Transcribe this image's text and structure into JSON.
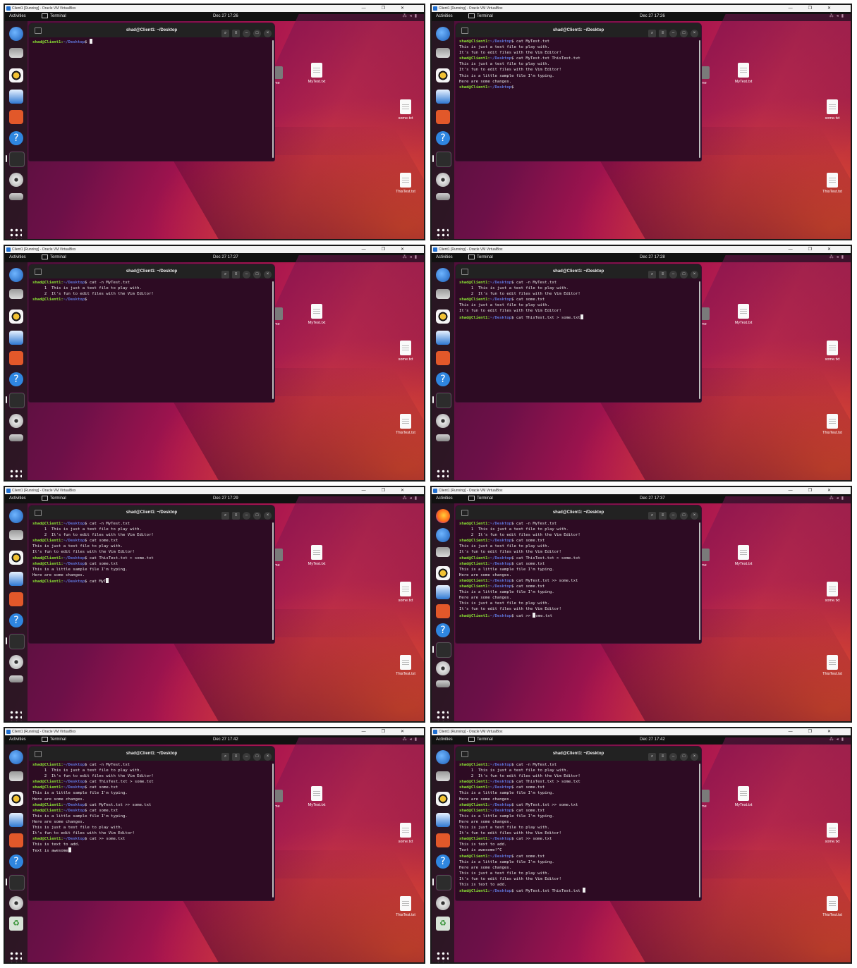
{
  "window_title": "Client1 [Running] - Oracle VM VirtualBox",
  "window_controls": [
    "—",
    "❐",
    "✕"
  ],
  "topbar": {
    "activities": "Activities",
    "app_name": "Terminal",
    "tray_icons": [
      "network-icon",
      "volume-icon",
      "battery-icon"
    ]
  },
  "terminal": {
    "title": "shad@Client1: ~/Desktop",
    "prompt_user": "shad@Client1:",
    "prompt_path": "~/Desktop",
    "prompt_sign": "$"
  },
  "desktop_files": [
    "MyTest.txt",
    "some.txt",
    "ThisTest.txt"
  ],
  "desktop_partial_label": "me",
  "dock_icons": [
    "thunderbird-icon",
    "files-icon",
    "rhythmbox-icon",
    "writer-icon",
    "app-center-icon",
    "help-icon",
    "terminal-icon",
    "disc-icon",
    "drive-icon",
    "show-apps-icon"
  ],
  "screens": [
    {
      "clock": "Dec 27  17:26",
      "lines": [
        {
          "p": true,
          "cmd": " ",
          "cursor": true
        }
      ],
      "term_height": 195
    },
    {
      "clock": "Dec 27  17:26",
      "lines": [
        {
          "p": true,
          "cmd": "cat MyTest.txt"
        },
        {
          "t": "This is just a test file to play with."
        },
        {
          "t": "It's fun to edit files with the Vim Editor!"
        },
        {
          "p": true,
          "cmd": "cat MyTest.txt ThisTest.txt"
        },
        {
          "t": "This is just a test file to play with."
        },
        {
          "t": "It's fun to edit files with the Vim Editor!"
        },
        {
          "t": "This is a little sample file I'm typing."
        },
        {
          "t": "Here are some changes."
        },
        {
          "p": true,
          "cmd": ""
        }
      ],
      "term_height": 195
    },
    {
      "clock": "Dec 27  17:27",
      "lines": [
        {
          "p": true,
          "cmd": "cat -n MyTest.txt"
        },
        {
          "t": "     1  This is just a test file to play with."
        },
        {
          "t": "     2  It's fun to edit files with the Vim Editor!"
        },
        {
          "p": true,
          "cmd": ""
        }
      ],
      "term_height": 195
    },
    {
      "clock": "Dec 27  17:28",
      "lines": [
        {
          "p": true,
          "cmd": "cat -n MyTest.txt"
        },
        {
          "t": "     1  This is just a test file to play with."
        },
        {
          "t": "     2  It's fun to edit files with the Vim Editor!"
        },
        {
          "p": true,
          "cmd": "cat some.txt"
        },
        {
          "t": "This is just a test file to play with."
        },
        {
          "t": "It's fun to edit files with the Vim Editor!"
        },
        {
          "p": true,
          "cmd": "cat ThisTest.txt > some.txt",
          "cursor": true
        }
      ],
      "term_height": 195
    },
    {
      "clock": "Dec 27  17:29",
      "lines": [
        {
          "p": true,
          "cmd": "cat -n MyTest.txt"
        },
        {
          "t": "     1  This is just a test file to play with."
        },
        {
          "t": "     2  It's fun to edit files with the Vim Editor!"
        },
        {
          "p": true,
          "cmd": "cat some.txt"
        },
        {
          "t": "This is just a test file to play with."
        },
        {
          "t": "It's fun to edit files with the Vim Editor!"
        },
        {
          "p": true,
          "cmd": "cat ThisTest.txt > some.txt"
        },
        {
          "p": true,
          "cmd": "cat some.txt"
        },
        {
          "t": "This is a little sample file I'm typing."
        },
        {
          "t": "Here are some changes."
        },
        {
          "p": true,
          "cmd": "cat MyT",
          "cursor": true
        }
      ],
      "term_height": 195
    },
    {
      "clock": "Dec 27  17:37",
      "lines": [
        {
          "p": true,
          "cmd": "cat -n MyTest.txt"
        },
        {
          "t": "     1  This is just a test file to play with."
        },
        {
          "t": "     2  It's fun to edit files with the Vim Editor!"
        },
        {
          "p": true,
          "cmd": "cat some.txt"
        },
        {
          "t": "This is just a test file to play with."
        },
        {
          "t": "It's fun to edit files with the Vim Editor!"
        },
        {
          "p": true,
          "cmd": "cat ThisTest.txt > some.txt"
        },
        {
          "p": true,
          "cmd": "cat some.txt"
        },
        {
          "t": "This is a little sample file I'm typing."
        },
        {
          "t": "Here are some changes."
        },
        {
          "p": true,
          "cmd": "cat MyTest.txt >> some.txt"
        },
        {
          "p": true,
          "cmd": "cat some.txt"
        },
        {
          "t": "This is a little sample file I'm typing."
        },
        {
          "t": "Here are some changes."
        },
        {
          "t": "This is just a test file to play with."
        },
        {
          "t": "It's fun to edit files with the Vim Editor!"
        },
        {
          "p": true,
          "cmd": "cat >> some.txt",
          "cursor_mid": true
        }
      ],
      "term_height": 195,
      "firefox": true
    },
    {
      "clock": "Dec 27  17:42",
      "lines": [
        {
          "p": true,
          "cmd": "cat -n MyTest.txt"
        },
        {
          "t": "     1  This is just a test file to play with."
        },
        {
          "t": "     2  It's fun to edit files with the Vim Editor!"
        },
        {
          "p": true,
          "cmd": "cat ThisTest.txt > some.txt"
        },
        {
          "p": true,
          "cmd": "cat some.txt"
        },
        {
          "t": "This is a little sample file I'm typing."
        },
        {
          "t": "Here are some changes."
        },
        {
          "p": true,
          "cmd": "cat MyTest.txt >> some.txt"
        },
        {
          "p": true,
          "cmd": "cat some.txt"
        },
        {
          "t": "This is a little sample file I'm typing."
        },
        {
          "t": "Here are some changes."
        },
        {
          "t": "This is just a test file to play with."
        },
        {
          "t": "It's fun to edit files with the Vim Editor!"
        },
        {
          "p": true,
          "cmd": "cat >> some.txt"
        },
        {
          "t": "This is text to add."
        },
        {
          "t": "Text is awesome",
          "cursor": true
        }
      ],
      "term_height": 218,
      "trash": true
    },
    {
      "clock": "Dec 27  17:42",
      "lines": [
        {
          "p": true,
          "cmd": "cat -n MyTest.txt"
        },
        {
          "t": "     1  This is just a test file to play with."
        },
        {
          "t": "     2  It's fun to edit files with the Vim Editor!"
        },
        {
          "p": true,
          "cmd": "cat ThisTest.txt > some.txt"
        },
        {
          "p": true,
          "cmd": "cat some.txt"
        },
        {
          "t": "This is a little sample file I'm typing."
        },
        {
          "t": "Here are some changes."
        },
        {
          "p": true,
          "cmd": "cat MyTest.txt >> some.txt"
        },
        {
          "p": true,
          "cmd": "cat some.txt"
        },
        {
          "t": "This is a little sample file I'm typing."
        },
        {
          "t": "Here are some changes."
        },
        {
          "t": "This is just a test file to play with."
        },
        {
          "t": "It's fun to edit files with the Vim Editor!"
        },
        {
          "p": true,
          "cmd": "cat >> some.txt"
        },
        {
          "t": "This is text to add."
        },
        {
          "t": "Text is awesome!^C"
        },
        {
          "p": true,
          "cmd": "cat some.txt"
        },
        {
          "t": "This is a little sample file I'm typing."
        },
        {
          "t": "Here are some changes."
        },
        {
          "t": "This is just a test file to play with."
        },
        {
          "t": "It's fun to edit files with the Vim Editor!"
        },
        {
          "t": "This is text to add."
        },
        {
          "p": true,
          "cmd": "cat MyTest.txt ThisTest.txt ",
          "cursor": true
        }
      ],
      "term_height": 218,
      "trash": true
    }
  ]
}
